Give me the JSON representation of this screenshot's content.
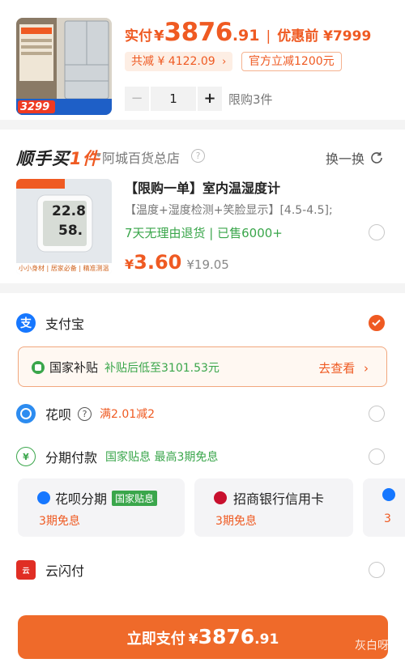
{
  "product": {
    "image_icon": "refrigerator-product-photo",
    "image_promo_price": "3299",
    "price_label": "实付",
    "currency": "¥",
    "price_int": "3876",
    "price_dec": ".91",
    "original_label": "优惠前 ¥7999",
    "discount_total": "共减 ¥ 4122.09",
    "official_discount": "官方立减1200元",
    "quantity": "1",
    "limit_text": "限购3件"
  },
  "bundle": {
    "title_main": "顺手买",
    "title_num": "1件",
    "store": "阿城百货总店",
    "swap_label": "换一换",
    "item": {
      "image_icon": "thermometer-hygrometer-photo",
      "image_temp": "22.8",
      "image_hum": "58.",
      "image_caption": "小小身材 | 居家必备 | 精准测温",
      "title": "【限购一单】室内温湿度计",
      "spec": "【温度+湿度检测+笑脸显示】[4.5-4.5];",
      "promo": "7天无理由退货 | 已售6000+",
      "currency": "¥",
      "price": "3.60",
      "old_price": "¥19.05"
    }
  },
  "payment": {
    "alipay": {
      "name": "支付宝",
      "icon": "alipay-icon",
      "selected": true
    },
    "subsidy": {
      "name": "国家补贴",
      "desc": "补贴后低至3101.53元",
      "action": "去查看",
      "icon": "subsidy-icon"
    },
    "huabei": {
      "name": "花呗",
      "desc": "满2.01减2",
      "icon": "huabei-icon"
    },
    "installment": {
      "name": "分期付款",
      "desc": "国家贴息 最高3期免息",
      "icon": "installment-icon"
    },
    "options": [
      {
        "name": "花呗分期",
        "badge": "国家贴息",
        "sub": "3期免息",
        "icon": "huabei-installment-icon"
      },
      {
        "name": "招商银行信用卡",
        "sub": "3期免息",
        "icon": "cmb-bank-icon"
      },
      {
        "name": "",
        "sub": "3",
        "icon": "partial-option-icon"
      }
    ],
    "unionpay": {
      "name": "云闪付",
      "icon": "unionpay-icon"
    }
  },
  "submit": {
    "label": "立即支付",
    "currency": "¥",
    "price_int": "3876",
    "price_dec": ".91",
    "watermark": "灰白呀"
  },
  "colors": {
    "accent": "#ef5a22",
    "green": "#3aa64b",
    "alipay_blue": "#1677ff"
  }
}
